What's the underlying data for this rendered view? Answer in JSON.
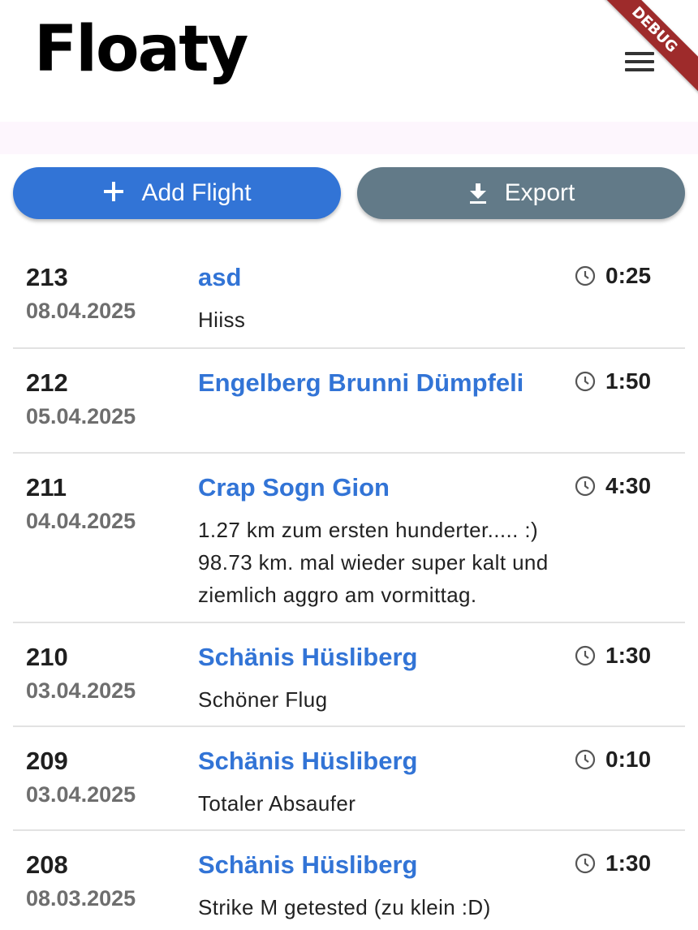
{
  "app": {
    "title": "Floaty",
    "debug_label": "DEBUG"
  },
  "actions": {
    "add_flight_label": "Add Flight",
    "export_label": "Export"
  },
  "icons": {
    "add": "plus-icon",
    "export": "download-icon",
    "menu": "hamburger-menu-icon",
    "duration": "clock-icon"
  },
  "colors": {
    "primary": "#3274d6",
    "secondary": "#627a88",
    "debug_ribbon": "#9e2b2b"
  },
  "flights": [
    {
      "number": "213",
      "date": "08.04.2025",
      "title": "asd",
      "description": "Hiiss",
      "duration": "0:25"
    },
    {
      "number": "212",
      "date": "05.04.2025",
      "title": "Engelberg Brunni Dümpfeli",
      "description": "",
      "duration": "1:50"
    },
    {
      "number": "211",
      "date": "04.04.2025",
      "title": "Crap Sogn Gion",
      "description": "1.27 km zum ersten hunderter..... :) 98.73 km. mal wieder super kalt und ziemlich aggro am vormittag.",
      "duration": "4:30"
    },
    {
      "number": "210",
      "date": "03.04.2025",
      "title": "Schänis Hüsliberg",
      "description": "Schöner Flug",
      "duration": "1:30"
    },
    {
      "number": "209",
      "date": "03.04.2025",
      "title": "Schänis Hüsliberg",
      "description": "Totaler Absaufer",
      "duration": "0:10"
    },
    {
      "number": "208",
      "date": "08.03.2025",
      "title": "Schänis Hüsliberg",
      "description": "Strike M getested (zu klein :D)",
      "duration": "1:30"
    }
  ]
}
